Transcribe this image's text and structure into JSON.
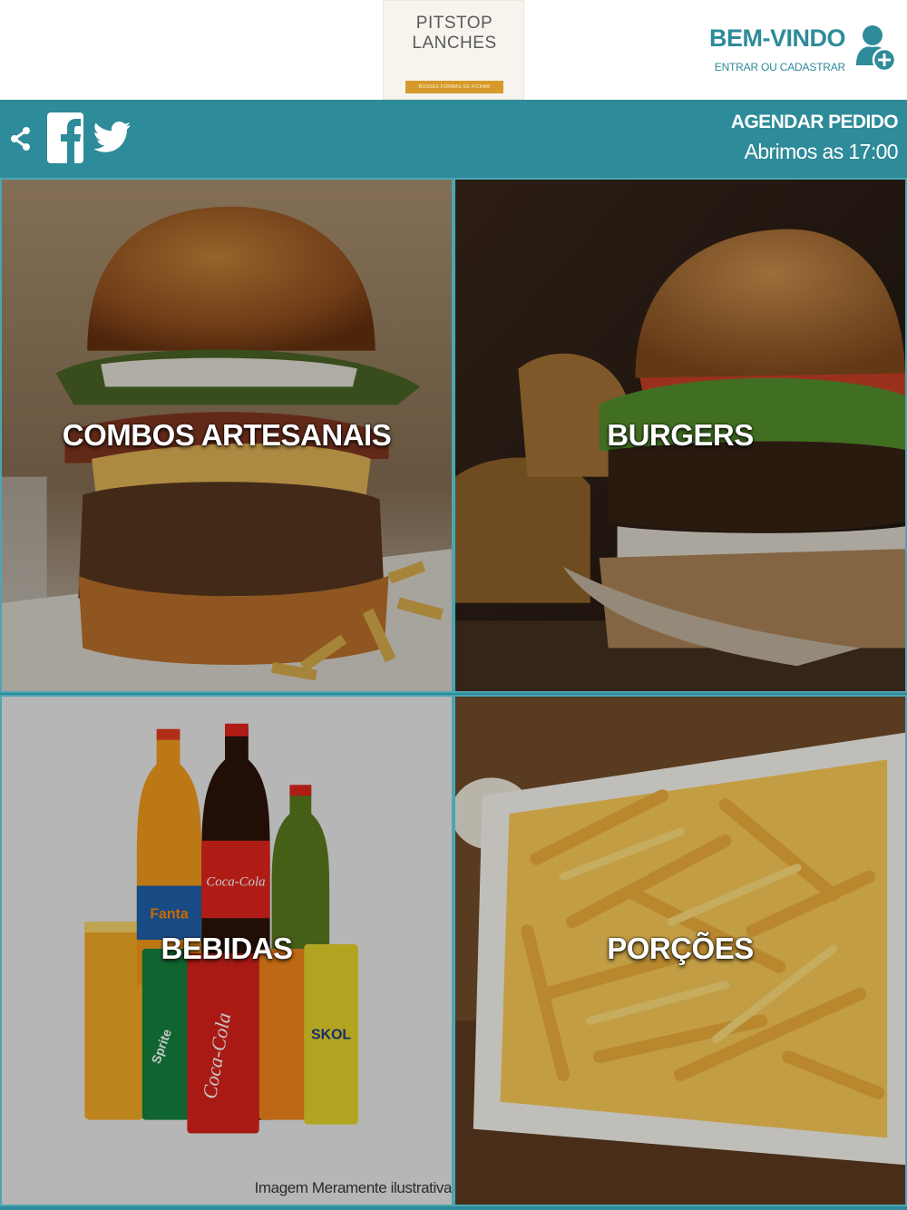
{
  "header": {
    "logo": {
      "line1": "PITSTOP",
      "line2": "LANCHES",
      "ribbon": "BOSSES FORMAS DE FICHAR"
    },
    "welcome_title": "BEM-VINDO",
    "welcome_subtitle": "ENTRAR OU CADASTRAR"
  },
  "toolbar": {
    "schedule_label": "AGENDAR PEDIDO",
    "opening_time": "Abrimos as 17:00"
  },
  "categories": [
    {
      "label": "COMBOS ARTESANAIS"
    },
    {
      "label": "BURGERS"
    },
    {
      "label": "BEBIDAS"
    },
    {
      "label": "PORÇÕES"
    }
  ],
  "drinks_art": {
    "fanta": "Fanta",
    "coca": "Coca-Cola",
    "sprite": "Sprite",
    "skol": "SKOL",
    "cola_can": "Coca-Cola"
  },
  "disclaimer": "Imagem Meramente ilustrativa",
  "colors": {
    "accent": "#2e8b99",
    "tile_border": "#4aa6b3"
  },
  "icons": [
    "share-icon",
    "facebook-icon",
    "twitter-icon",
    "user-add-icon"
  ]
}
